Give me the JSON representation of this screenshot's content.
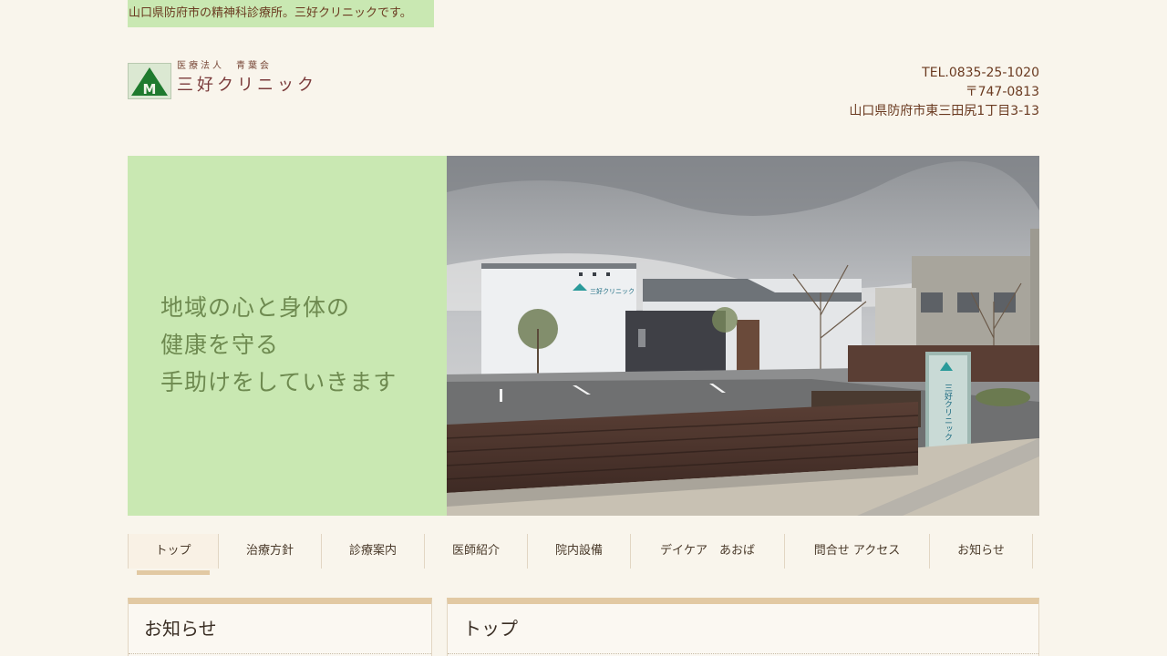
{
  "banner": {
    "text": "山口県防府市の精神科診療所。三好クリニックです。"
  },
  "logo": {
    "subtitle": "医療法人　青葉会",
    "name": "三好クリニック",
    "mark_letter": "M"
  },
  "contact": {
    "tel": "TEL.0835-25-1020",
    "postal": "〒747-0813",
    "address": "山口県防府市東三田尻1丁目3-13"
  },
  "hero": {
    "copy_lines": [
      "地域の心と身体の",
      "健康を守る",
      "手助けをしていきます"
    ],
    "sign_text": "三好クリニック",
    "building_sign": "三好クリニック"
  },
  "nav": {
    "items": [
      {
        "label": "トップ",
        "active": true
      },
      {
        "label": "治療方針",
        "active": false
      },
      {
        "label": "診療案内",
        "active": false
      },
      {
        "label": "医師紹介",
        "active": false
      },
      {
        "label": "院内設備",
        "active": false
      },
      {
        "label": "デイケア　あおば",
        "active": false
      },
      {
        "label": "問合せ アクセス",
        "active": false
      },
      {
        "label": "お知らせ",
        "active": false
      }
    ]
  },
  "panels": {
    "sidebar_title": "お知らせ",
    "main_title": "トップ"
  },
  "colors": {
    "page_bg": "#f9f5ec",
    "accent_green": "#c9e8b2",
    "nav_underline": "#e2c9a3",
    "logo_green": "#1f7a2e"
  }
}
